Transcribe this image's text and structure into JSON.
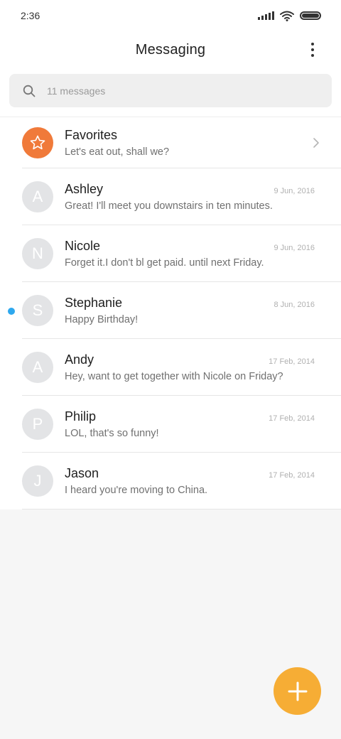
{
  "status_bar": {
    "time": "2:36"
  },
  "header": {
    "title": "Messaging",
    "menu_icon": "more-vertical-icon"
  },
  "search": {
    "placeholder": "11 messages",
    "icon": "search-icon"
  },
  "favorites": {
    "name": "Favorites",
    "preview": "Let's eat out, shall we?",
    "icon": "star-icon"
  },
  "conversations": [
    {
      "initial": "A",
      "name": "Ashley",
      "date": "9 Jun, 2016",
      "preview": "Great! I'll meet you downstairs in ten minutes.",
      "unread": false
    },
    {
      "initial": "N",
      "name": "Nicole",
      "date": "9 Jun, 2016",
      "preview": "Forget it.I don't bl get paid. until next Friday.",
      "unread": false
    },
    {
      "initial": "S",
      "name": "Stephanie",
      "date": "8 Jun, 2016",
      "preview": "Happy Birthday!",
      "unread": true
    },
    {
      "initial": "A",
      "name": "Andy",
      "date": "17 Feb, 2014",
      "preview": "Hey, want to get together with Nicole on Friday?",
      "unread": false
    },
    {
      "initial": "P",
      "name": "Philip",
      "date": "17 Feb, 2014",
      "preview": "LOL, that's so funny!",
      "unread": false
    },
    {
      "initial": "J",
      "name": "Jason",
      "date": "17 Feb, 2014",
      "preview": "I heard you're moving to China.",
      "unread": false
    }
  ],
  "colors": {
    "accent_orange": "#f07a3a",
    "fab": "#f6ad35",
    "unread_dot": "#2ea8ee",
    "avatar_bg": "#e3e4e6"
  },
  "fab": {
    "icon": "plus-icon"
  }
}
